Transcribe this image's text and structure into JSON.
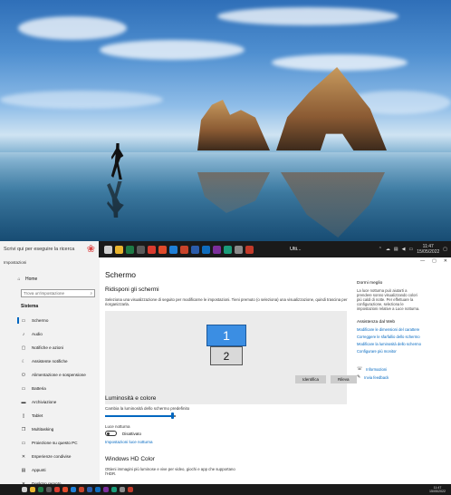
{
  "taskbar_top": {
    "search_placeholder": "Scrivi qui per eseguire la ricerca",
    "active_app_label": "Ulti...",
    "time": "11:47",
    "date": "15/05/2022",
    "apps": [
      {
        "icon": "task-view-icon",
        "color": "#cfcfcf"
      },
      {
        "icon": "file-explorer-icon",
        "color": "#e9b52f"
      },
      {
        "icon": "excel-icon",
        "color": "#1d7a45"
      },
      {
        "icon": "store-icon",
        "color": "#5a5a5a"
      },
      {
        "icon": "chrome-icon",
        "color": "#d93b2f"
      },
      {
        "icon": "app-icon",
        "color": "#e04a2a"
      },
      {
        "icon": "camera-icon",
        "color": "#1f7fd6"
      },
      {
        "icon": "powerpoint-icon",
        "color": "#c8432a"
      },
      {
        "icon": "word-icon",
        "color": "#2b5cab"
      },
      {
        "icon": "outlook-icon",
        "color": "#0f6cbd"
      },
      {
        "icon": "onenote-icon",
        "color": "#7b2e9b"
      },
      {
        "icon": "edge-icon",
        "color": "#1a9c7a"
      },
      {
        "icon": "settings-icon",
        "color": "#8a8a8a"
      },
      {
        "icon": "pinned-red-icon",
        "color": "#c23a2a"
      }
    ]
  },
  "settings": {
    "app_title": "Impostazioni",
    "home_label": "Home",
    "find_placeholder": "Trova un'impostazione",
    "section_label": "Sistema",
    "nav": [
      {
        "label": "Schermo",
        "icon": "display-icon",
        "glyph": "▭"
      },
      {
        "label": "Audio",
        "icon": "speaker-icon",
        "glyph": "♪"
      },
      {
        "label": "Notifiche e azioni",
        "icon": "notification-icon",
        "glyph": "▢"
      },
      {
        "label": "Assistente notifiche",
        "icon": "moon-icon",
        "glyph": "☾"
      },
      {
        "label": "Alimentazione e sospensione",
        "icon": "power-icon",
        "glyph": "⏻"
      },
      {
        "label": "Batteria",
        "icon": "battery-icon",
        "glyph": "▭"
      },
      {
        "label": "Archiviazione",
        "icon": "storage-icon",
        "glyph": "▬"
      },
      {
        "label": "Tablet",
        "icon": "tablet-icon",
        "glyph": "▯"
      },
      {
        "label": "Multitasking",
        "icon": "multitasking-icon",
        "glyph": "❐"
      },
      {
        "label": "Proiezione su questo PC",
        "icon": "projection-icon",
        "glyph": "▭"
      },
      {
        "label": "Esperienze condivise",
        "icon": "shared-icon",
        "glyph": "✕"
      },
      {
        "label": "Appunti",
        "icon": "clipboard-icon",
        "glyph": "▤"
      },
      {
        "label": "Desktop remoto",
        "icon": "remote-desktop-icon",
        "glyph": "✕"
      },
      {
        "label": "Informazioni",
        "icon": "info-icon",
        "glyph": "ⓘ"
      }
    ],
    "page_title": "Schermo",
    "arrange_heading": "Ridisponi gli schermi",
    "arrange_desc": "Seleziona una visualizzazione di seguito per modificarne le impostazioni. Tieni premuto (o seleziona) una visualizzazione, quindi trascina per riorganizzarla.",
    "monitor_1": "1",
    "monitor_2": "2",
    "identify_label": "Identifica",
    "detect_label": "Rileva",
    "brightness_heading": "Luminosità e colore",
    "brightness_label": "Cambia la luminosità dello schermo predefinito",
    "brightness_level": 0.95,
    "night_light_label": "Luce notturna",
    "night_light_state": "Disattivato",
    "night_light_link": "Impostazioni luce notturna",
    "hdr_heading": "Windows HD Color",
    "hdr_desc": "Ottieni immagini più luminose e vive per video, giochi e app che supportano l'HDR.",
    "right": {
      "heading_1": "Dormi meglio",
      "text_1": "La luce notturna può aiutarti a prendere sonno visualizzando colori più caldi di notte. Per effettuare la configurazione, seleziona le impostazioni relative a Luce notturna.",
      "heading_2": "Assistenza dal Web",
      "links": [
        "Modificare le dimensioni del carattere",
        "Correggere le sfarfallio dello schermo",
        "Modificare la luminosità dello schermo",
        "Configurare più monitor"
      ],
      "help_label": "Informazioni",
      "feedback_label": "Invia feedback"
    }
  },
  "taskbar_bottom": {
    "time": "11:47",
    "date": "15/05/2022",
    "apps": [
      {
        "icon": "task-view-icon",
        "color": "#cfcfcf"
      },
      {
        "icon": "file-explorer-icon",
        "color": "#e9b52f"
      },
      {
        "icon": "excel-icon",
        "color": "#1d7a45"
      },
      {
        "icon": "store-icon",
        "color": "#5a5a5a"
      },
      {
        "icon": "chrome-icon",
        "color": "#d93b2f"
      },
      {
        "icon": "app-icon",
        "color": "#e04a2a"
      },
      {
        "icon": "camera-icon",
        "color": "#1f7fd6"
      },
      {
        "icon": "powerpoint-icon",
        "color": "#c8432a"
      },
      {
        "icon": "word-icon",
        "color": "#2b5cab"
      },
      {
        "icon": "outlook-icon",
        "color": "#0f6cbd"
      },
      {
        "icon": "onenote-icon",
        "color": "#7b2e9b"
      },
      {
        "icon": "edge-icon",
        "color": "#1a9c7a"
      },
      {
        "icon": "settings-icon",
        "color": "#8a8a8a"
      },
      {
        "icon": "pinned-red-icon",
        "color": "#c23a2a"
      }
    ]
  }
}
